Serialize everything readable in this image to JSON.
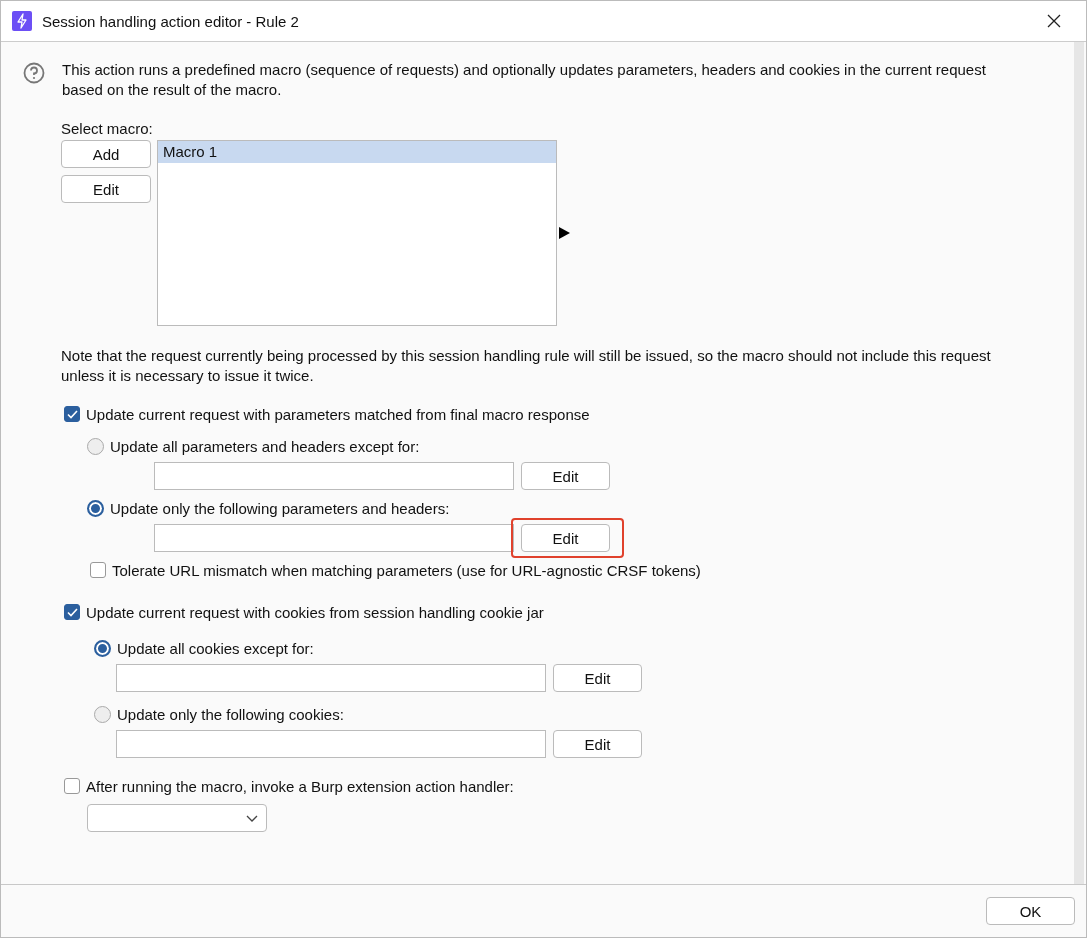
{
  "window": {
    "title": "Session handling action editor - Rule 2"
  },
  "description": "This action runs a predefined macro (sequence of requests) and optionally updates parameters, headers and cookies in the current request based on the result of the macro.",
  "macro": {
    "label": "Select macro:",
    "buttons": [
      "Add",
      "Edit"
    ],
    "items": [
      {
        "label": "Macro 1",
        "selected": true
      }
    ]
  },
  "note": "Note that the request currently being processed by this session handling rule will still be issued, so the macro should not include this request unless it is necessary to issue it twice.",
  "sections": [
    {
      "kind": "options",
      "label": "Update current request with parameters matched from final macro response",
      "checked": true,
      "options": [
        {
          "kind": "radio",
          "label": "Update all parameters and headers except for:",
          "selected": false,
          "button": "Edit",
          "highlighted": false
        },
        {
          "kind": "radio",
          "label": "Update only the following parameters and headers:",
          "selected": true,
          "button": "Edit",
          "highlighted": true
        },
        {
          "kind": "checkbox",
          "label": "Tolerate URL mismatch when matching parameters (use for URL-agnostic CRSF tokens)",
          "checked": false
        }
      ]
    },
    {
      "kind": "options",
      "label": "Update current request with cookies from session handling cookie jar",
      "checked": true,
      "options": [
        {
          "kind": "radio",
          "label": "Update all cookies except for:",
          "selected": true,
          "button": "Edit",
          "highlighted": false
        },
        {
          "kind": "radio",
          "label": "Update only the following cookies:",
          "selected": false,
          "button": "Edit",
          "highlighted": false
        }
      ]
    },
    {
      "kind": "dropdown",
      "label": "After running the macro, invoke a Burp extension action handler:",
      "checked": false
    }
  ],
  "buttons": [
    "OK"
  ]
}
